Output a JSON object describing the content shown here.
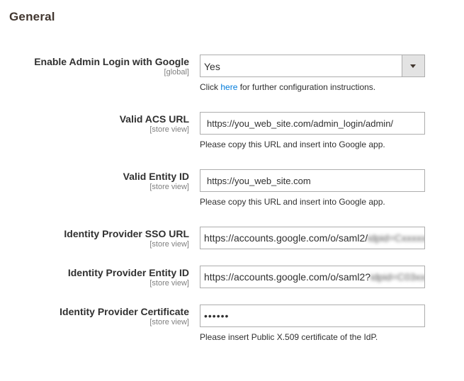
{
  "section": {
    "title": "General"
  },
  "fields": {
    "enable_login": {
      "label": "Enable Admin Login with Google",
      "scope": "[global]",
      "value": "Yes",
      "note_prefix": "Click",
      "note_link": "here",
      "note_suffix": "for further configuration instructions."
    },
    "acs_url": {
      "label": "Valid ACS URL",
      "scope": "[store view]",
      "value": "https://you_web_site.com/admin_login/admin/",
      "note": "Please copy this URL and insert into Google app."
    },
    "entity_id": {
      "label": "Valid Entity ID",
      "scope": "[store view]",
      "value": "https://you_web_site.com",
      "note": "Please copy this URL and insert into Google app."
    },
    "sso_url": {
      "label": "Identity Provider SSO URL",
      "scope": "[store view]",
      "value": "https://accounts.google.com/o/saml2/",
      "redacted": "idpid=Cxxxxxxx"
    },
    "provider_entity_id": {
      "label": "Identity Provider Entity ID",
      "scope": "[store view]",
      "value": "https://accounts.google.com/o/saml2?",
      "redacted": "idpid=C03xxxx"
    },
    "certificate": {
      "label": "Identity Provider Certificate",
      "scope": "[store view]",
      "value": "••••••",
      "note": "Please insert Public X.509 certificate of the IdP."
    }
  }
}
